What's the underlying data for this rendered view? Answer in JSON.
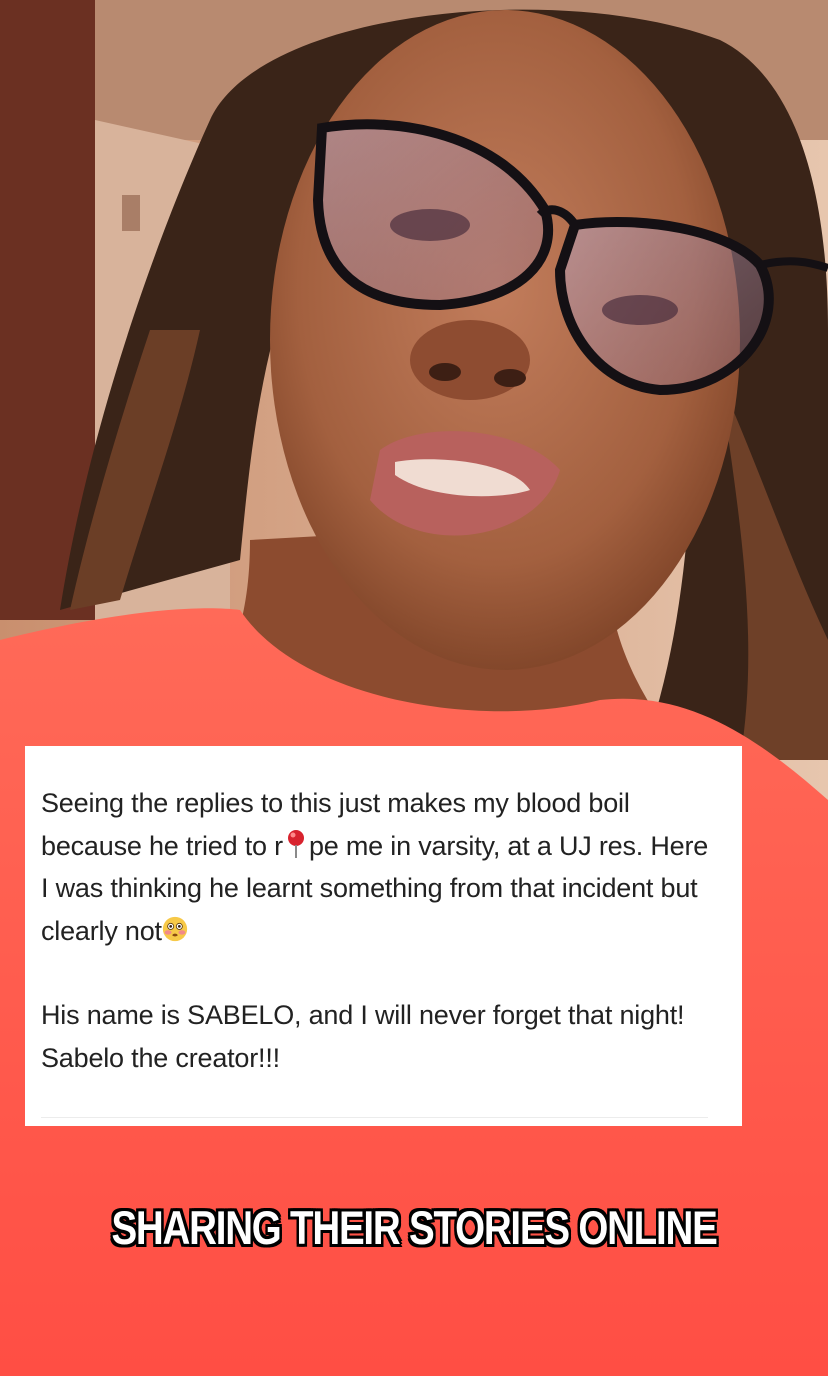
{
  "post": {
    "paragraph1_before_pin": "Seeing the replies to this just makes my blood boil because he tried to r",
    "paragraph1_after_pin": "pe me in varsity, at a UJ res. Here I was thinking he learnt something from that incident but clearly not",
    "paragraph2": "His name is SABELO,  and I will never forget that night! Sabelo the creator!!!",
    "pin_icon": "round-pushpin-emoji",
    "flushed_icon": "flushed-face-emoji"
  },
  "subtitle": "SHARING THEIR STORIES ONLINE",
  "colors": {
    "shirt": "#ff5a4a",
    "card_background": "#ffffff",
    "card_text": "#222222",
    "subtitle_fill": "#ffffff",
    "subtitle_outline": "#000000"
  }
}
